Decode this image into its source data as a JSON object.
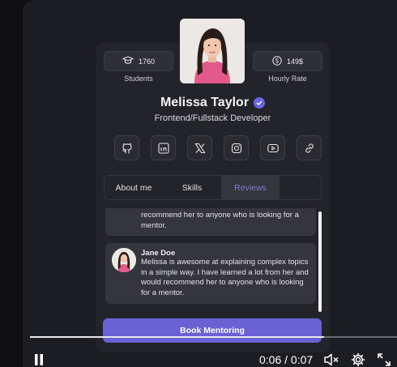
{
  "stats": {
    "students": {
      "value": "1760",
      "label": "Students",
      "icon": "graduation-cap-icon"
    },
    "rate": {
      "value": "149$",
      "label": "Hourly Rate",
      "icon": "dollar-icon"
    }
  },
  "profile": {
    "name": "Melissa Taylor",
    "role": "Frontend/Fullstack Developer",
    "photo_icon": "profile-photo"
  },
  "socials": [
    "github-icon",
    "linkedin-icon",
    "x-icon",
    "instagram-icon",
    "youtube-icon",
    "link-icon"
  ],
  "tabs": [
    {
      "label": "About me",
      "active": false
    },
    {
      "label": "Skills",
      "active": false
    },
    {
      "label": "Reviews",
      "active": true
    }
  ],
  "reviews": [
    {
      "text_line1": "recommend her to anyone who is looking for a",
      "text_line2": "mentor."
    },
    {
      "name": "Jane Doe",
      "text": "Melissa is awesome at explaining complex topics in a simple way. I have learned a lot from her and would recommend her to anyone who is looking for a mentor."
    }
  ],
  "book_button": "Book Mentoring",
  "player": {
    "time": "0:06 / 0:07",
    "progress": 0.8
  },
  "colors": {
    "accent": "#6a61d4",
    "verified": "#6b63e6"
  }
}
